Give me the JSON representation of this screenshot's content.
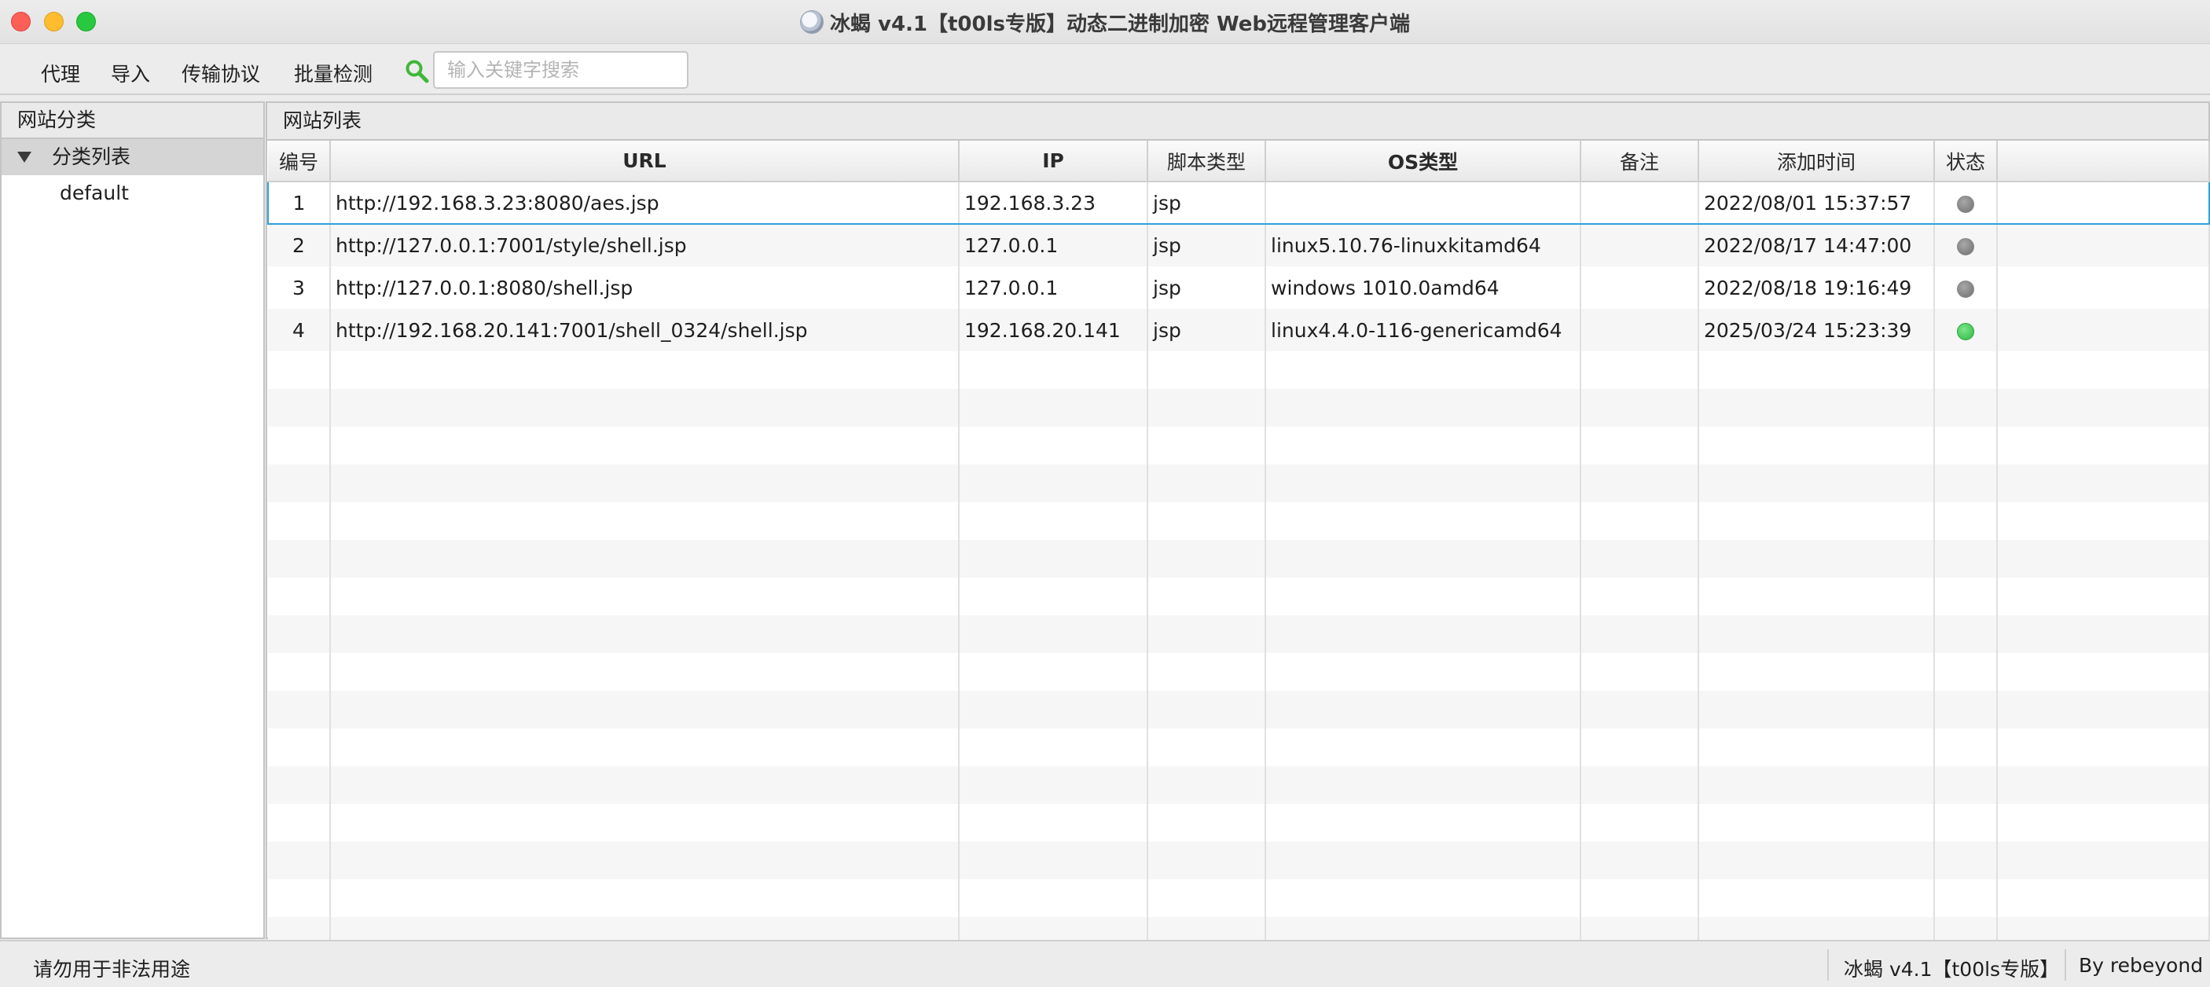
{
  "window": {
    "title": "冰蝎 v4.1【t00ls专版】动态二进制加密 Web远程管理客户端",
    "app_icon": "scorpion-app-icon"
  },
  "menu": {
    "items": [
      "代理",
      "导入",
      "传输协议",
      "批量检测"
    ]
  },
  "search": {
    "placeholder": "输入关键字搜索",
    "value": "",
    "icon": "search-icon"
  },
  "left_panel": {
    "header": "网站分类",
    "tree": {
      "root_label": "分类列表",
      "children": [
        "default"
      ]
    }
  },
  "right_panel": {
    "header": "网站列表",
    "columns": [
      "编号",
      "URL",
      "IP",
      "脚本类型",
      "OS类型",
      "备注",
      "添加时间",
      "状态"
    ],
    "rows": [
      {
        "id": "1",
        "url": "http://192.168.3.23:8080/aes.jsp",
        "ip": "192.168.3.23",
        "script": "jsp",
        "os": "",
        "note": "",
        "added": "2022/08/01 15:37:57",
        "status": "offline",
        "selected": true
      },
      {
        "id": "2",
        "url": "http://127.0.0.1:7001/style/shell.jsp",
        "ip": "127.0.0.1",
        "script": "jsp",
        "os": "linux5.10.76-linuxkitamd64",
        "note": "",
        "added": "2022/08/17 14:47:00",
        "status": "offline",
        "selected": false
      },
      {
        "id": "3",
        "url": "http://127.0.0.1:8080/shell.jsp",
        "ip": "127.0.0.1",
        "script": "jsp",
        "os": "windows 1010.0amd64",
        "note": "",
        "added": "2022/08/18 19:16:49",
        "status": "offline",
        "selected": false
      },
      {
        "id": "4",
        "url": "http://192.168.20.141:7001/shell_0324/shell.jsp",
        "ip": "192.168.20.141",
        "script": "jsp",
        "os": "linux4.4.0-116-genericamd64",
        "note": "",
        "added": "2025/03/24 15:23:39",
        "status": "online",
        "selected": false
      }
    ],
    "status_colors": {
      "offline": "#7a7a7a",
      "online": "#34c44c"
    }
  },
  "statusbar": {
    "left": "请勿用于非法用途",
    "version": "冰蝎 v4.1【t00ls专版】",
    "author": "By rebeyond"
  },
  "colors": {
    "selection_border": "#2ea2d8",
    "close": "#fe5f57",
    "minimize": "#febc2e",
    "maximize": "#28c840"
  }
}
